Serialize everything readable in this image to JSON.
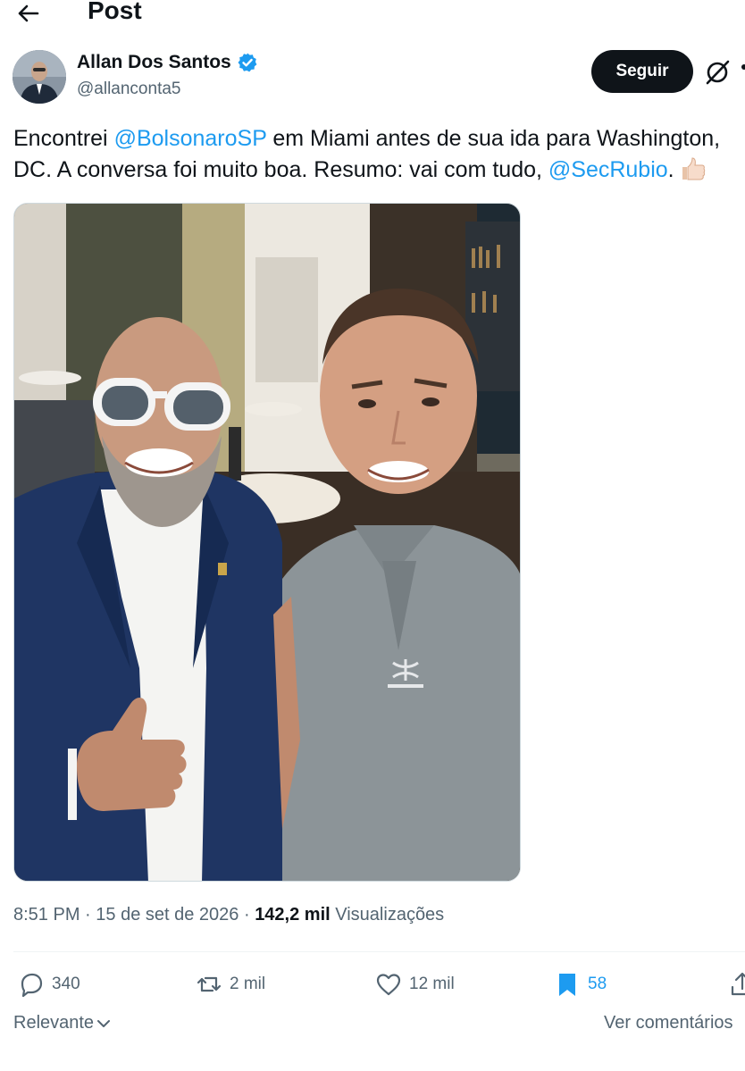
{
  "header": {
    "title": "Post"
  },
  "author": {
    "name": "Allan Dos Santos",
    "handle": "@allanconta5",
    "follow_label": "Seguir"
  },
  "tweet": {
    "text_1": "Encontrei ",
    "mention_1": "@BolsonaroSP",
    "text_2": " em Miami antes de sua ida para Washington,",
    "text_3": "DC. A conversa foi muito boa. Resumo: vai com tudo, ",
    "mention_2": "@SecRubio",
    "text_4": "."
  },
  "meta": {
    "time": "8:51 PM",
    "sep1": " · ",
    "date": "15 de set de 2026",
    "sep2": " · ",
    "views_count": "142,2 mil",
    "views_label": " Visualizações"
  },
  "actions": {
    "replies": "340",
    "reposts": "2 mil",
    "likes": "12 mil",
    "bookmarks": "58"
  },
  "replies_bar": {
    "sort_label": "Relevante",
    "see_comments": "Ver comentários"
  },
  "colors": {
    "accent": "#1d9bf0",
    "text": "#0f1419",
    "muted": "#536471",
    "verified": "#1d9bf0"
  },
  "icons": [
    "back-arrow-icon",
    "verified-badge-icon",
    "grok-icon",
    "thumbs-up-emoji-icon",
    "reply-icon",
    "repost-icon",
    "like-icon",
    "bookmark-icon",
    "share-icon",
    "chevron-down-icon"
  ]
}
